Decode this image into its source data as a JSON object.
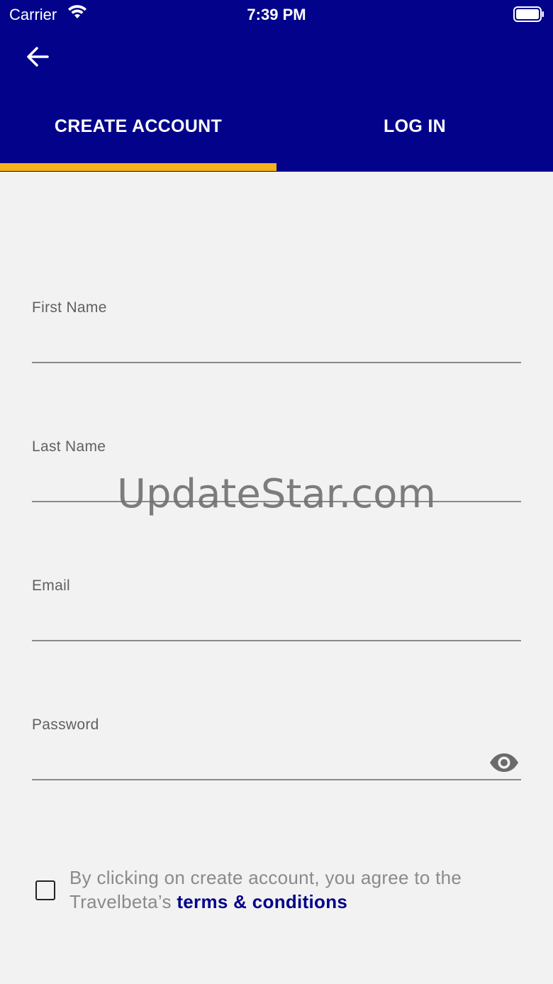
{
  "status_bar": {
    "carrier": "Carrier",
    "time": "7:39 PM",
    "wifi_icon": "wifi-icon",
    "battery_icon": "battery-icon"
  },
  "header": {
    "back_icon": "arrow-left-icon",
    "background_color": "#02028a",
    "accent_color": "#f5b21b"
  },
  "tabs": [
    {
      "label": "CREATE ACCOUNT",
      "active": true
    },
    {
      "label": "LOG IN",
      "active": false
    }
  ],
  "form": {
    "first_name": {
      "label": "First Name",
      "value": ""
    },
    "last_name": {
      "label": "Last Name",
      "value": ""
    },
    "email": {
      "label": "Email",
      "value": ""
    },
    "password": {
      "label": "Password",
      "value": "",
      "toggle_icon": "eye-icon"
    }
  },
  "watermark": "UpdateStar.com",
  "terms": {
    "checked": false,
    "text_line1": "By clicking on create account, you agree to the",
    "text_prefix": "Travelbeta’s ",
    "link_label": "terms & conditions"
  }
}
